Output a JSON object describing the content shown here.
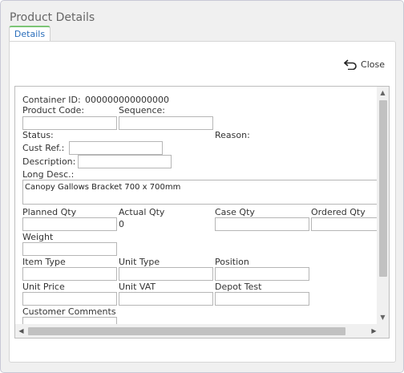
{
  "window": {
    "title": "Product Details"
  },
  "tabs": [
    {
      "label": "Details"
    }
  ],
  "toolbar": {
    "close_label": "Close"
  },
  "form": {
    "container_id_label": "Container ID:",
    "container_id_value": "000000000000000",
    "product_code_label": "Product Code:",
    "product_code_value": "",
    "sequence_label": "Sequence:",
    "sequence_value": "",
    "status_label": "Status:",
    "reason_label": "Reason:",
    "cust_ref_label": "Cust Ref.:",
    "cust_ref_value": "",
    "description_label": "Description:",
    "description_value": "",
    "long_desc_label": "Long Desc.:",
    "long_desc_value": "Canopy Gallows Bracket 700 x 700mm",
    "planned_qty_label": "Planned Qty",
    "planned_qty_value": "",
    "actual_qty_label": "Actual Qty",
    "actual_qty_value": "0",
    "case_qty_label": "Case Qty",
    "case_qty_value": "",
    "ordered_qty_label": "Ordered Qty",
    "ordered_qty_value": "",
    "weight_label": "Weight",
    "weight_value": "",
    "item_type_label": "Item Type",
    "item_type_value": "",
    "unit_type_label": "Unit Type",
    "unit_type_value": "",
    "position_label": "Position",
    "position_value": "",
    "unit_price_label": "Unit Price",
    "unit_price_value": "",
    "unit_vat_label": "Unit VAT",
    "unit_vat_value": "",
    "depot_test_label": "Depot Test",
    "depot_test_value": "",
    "customer_comments_label": "Customer Comments",
    "customer_comments_value": ""
  },
  "scrollbar": {
    "up_arrow": "▲",
    "down_arrow": "▼",
    "left_arrow": "◀",
    "right_arrow": "▶"
  },
  "colors": {
    "tab_accent": "#7cc576",
    "tab_text": "#2a6ebb"
  }
}
